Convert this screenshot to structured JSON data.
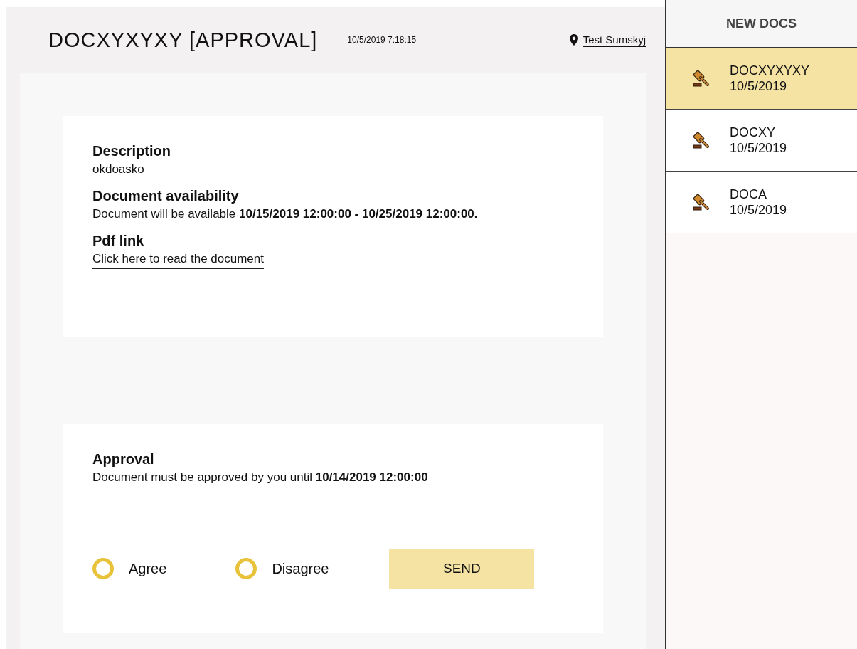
{
  "header": {
    "title": "DOCXYXYXY [APPROVAL]",
    "timestamp": "10/5/2019 7:18:15",
    "user": "Test Sumskyj"
  },
  "details": {
    "description_heading": "Description",
    "description": "okdoasko",
    "availability_heading": "Document availability",
    "availability": "Document will be available **10/15/2019 12:00:00 - 10/25/2019 12:00:00.**",
    "pdf_heading": "Pdf link",
    "pdf_link": "Click here to read the document"
  },
  "approval": {
    "heading": "Approval",
    "text": "Document must be approved by you until **10/14/2019 12:00:00**",
    "options": [
      {
        "label": "Agree",
        "selected": false
      },
      {
        "label": "Disagree",
        "selected": false
      }
    ],
    "button": "SEND"
  },
  "sidebar": {
    "title": "NEW DOCS",
    "items": [
      {
        "name": "DOCXYXYXY",
        "date": "10/5/2019",
        "selected": true
      },
      {
        "name": "DOCXY",
        "date": "10/5/2019",
        "selected": false
      },
      {
        "name": "DOCA",
        "date": "10/5/2019",
        "selected": false
      }
    ]
  }
}
